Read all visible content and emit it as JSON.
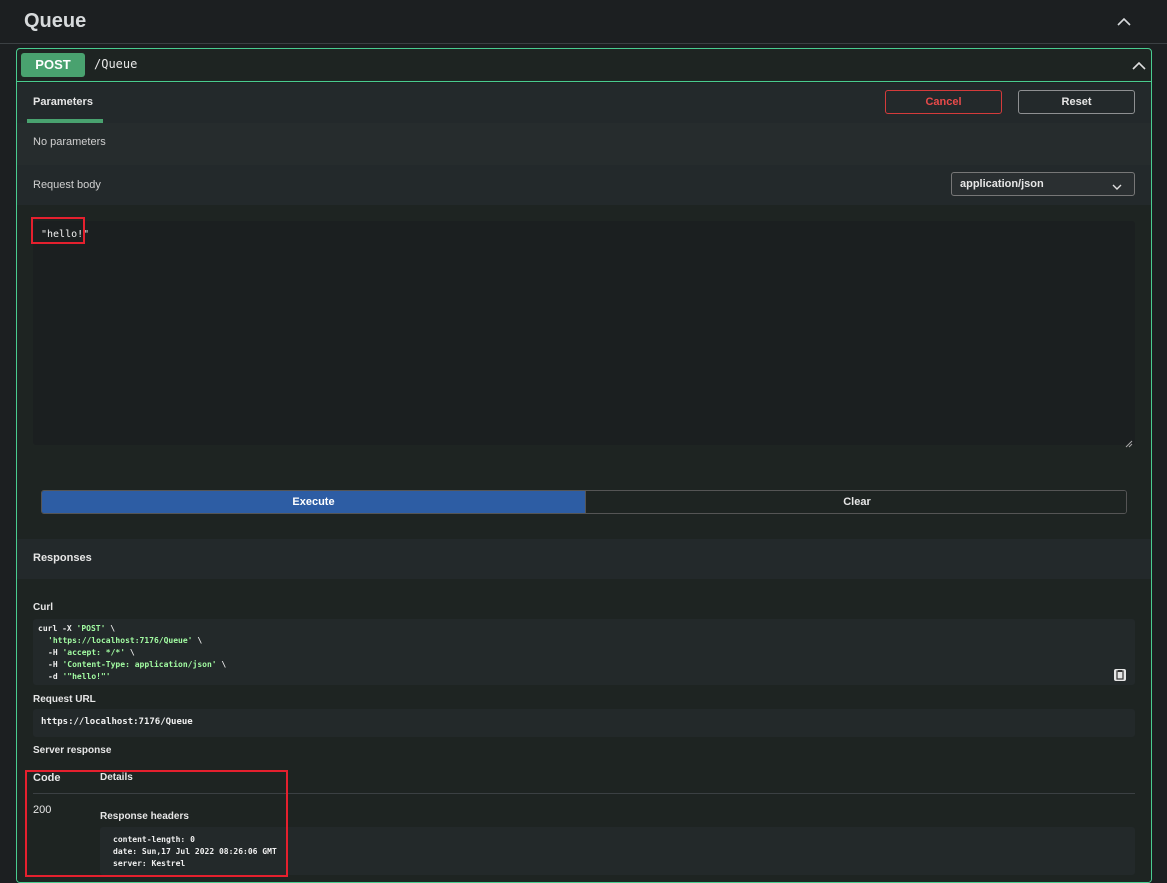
{
  "section": {
    "title": "Queue"
  },
  "operation": {
    "method": "POST",
    "path": "/Queue"
  },
  "parameters": {
    "tab_label": "Parameters",
    "cancel_label": "Cancel",
    "reset_label": "Reset",
    "empty_text": "No parameters"
  },
  "request_body": {
    "label": "Request body",
    "content_type": "application/json",
    "value": "\"hello!\""
  },
  "actions": {
    "execute_label": "Execute",
    "clear_label": "Clear"
  },
  "responses": {
    "title": "Responses",
    "curl_label": "Curl",
    "curl": {
      "l1_cmd": "curl -X ",
      "l1_method": "'POST'",
      "l1_end": " \\",
      "l2_url": "'https://localhost:7176/Queue'",
      "l2_end": " \\",
      "l3_flag": "-H ",
      "l3_val": "'accept: */*'",
      "l3_end": " \\",
      "l4_flag": "-H ",
      "l4_val": "'Content-Type: application/json'",
      "l4_end": " \\",
      "l5_flag": "-d ",
      "l5_val": "'\"hello!\"'"
    },
    "request_url_label": "Request URL",
    "request_url": "https://localhost:7176/Queue",
    "server_response_label": "Server response",
    "code_header": "Code",
    "details_header": "Details",
    "status_code": "200",
    "response_headers_label": "Response headers",
    "headers": [
      "content-length: 0",
      "date: Sun,17 Jul 2022 08:26:06 GMT",
      "server: Kestrel"
    ]
  },
  "colors": {
    "post_green": "#49a26f",
    "border_green": "#49cc90",
    "execute_blue": "#2d5da4",
    "cancel_red": "#e84a4a",
    "highlight_red": "#e5202e"
  }
}
